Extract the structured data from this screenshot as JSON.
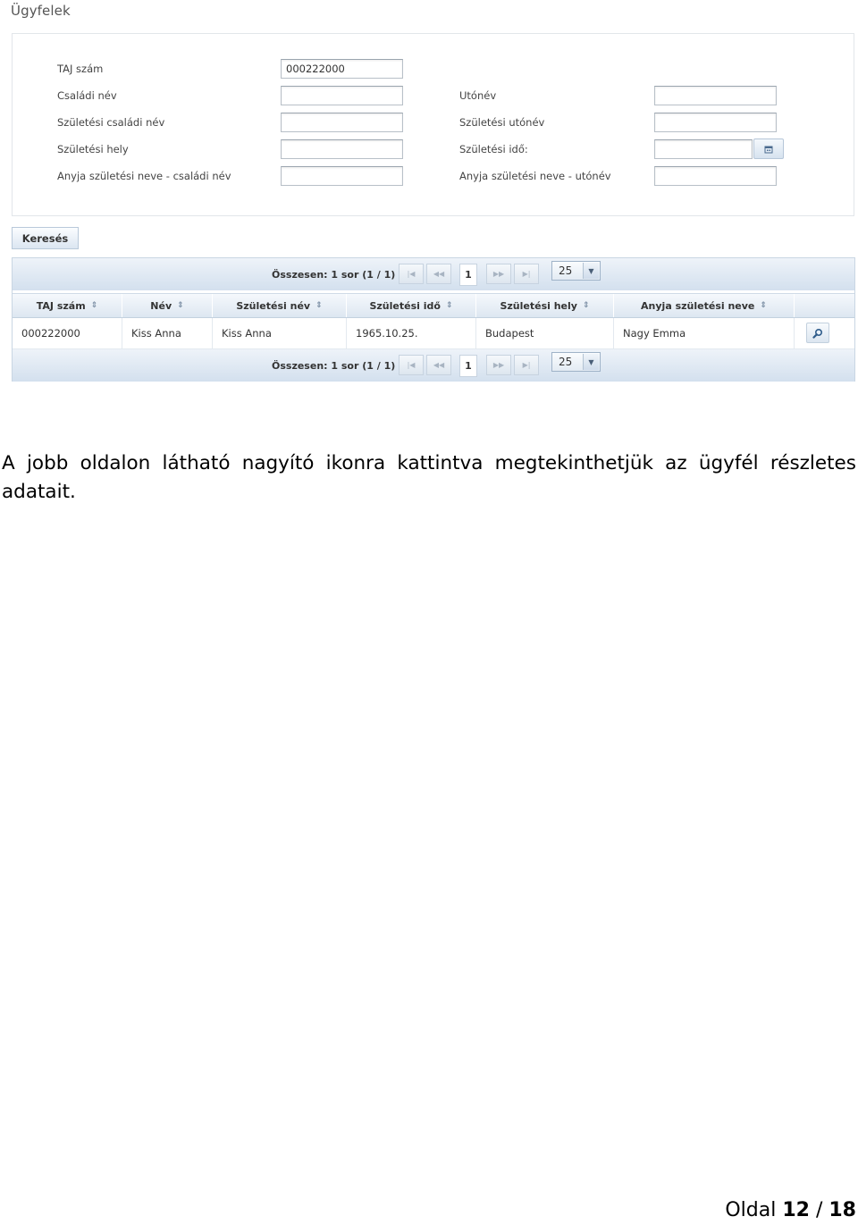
{
  "page": {
    "title": "Ügyfelek"
  },
  "search_form": {
    "fields": [
      {
        "label": "TAJ szám",
        "value": "000222000"
      },
      {
        "label": "Családi név",
        "value": ""
      },
      {
        "label": "Utónév",
        "value": ""
      },
      {
        "label": "Születési családi név",
        "value": ""
      },
      {
        "label": "Születési utónév",
        "value": ""
      },
      {
        "label": "Születési hely",
        "value": ""
      },
      {
        "label": "Születési idő:",
        "value": ""
      },
      {
        "label": "Anyja születési neve - családi név",
        "value": ""
      },
      {
        "label": "Anyja születési neve - utónév",
        "value": ""
      }
    ],
    "search_button": "Keresés"
  },
  "grid": {
    "pager": {
      "summary": "Összesen: 1 sor (1 / 1)",
      "current_page": "1",
      "page_size": "25",
      "first": "|◀",
      "prev": "◀◀",
      "next": "▶▶",
      "last": "▶|"
    },
    "columns": [
      {
        "label": "TAJ szám"
      },
      {
        "label": "Név"
      },
      {
        "label": "Születési név"
      },
      {
        "label": "Születési idő"
      },
      {
        "label": "Születési hely"
      },
      {
        "label": "Anyja születési neve"
      }
    ],
    "rows": [
      [
        "000222000",
        "Kiss Anna",
        "Kiss Anna",
        "1965.10.25.",
        "Budapest",
        "Nagy Emma"
      ]
    ],
    "sort_glyph": "⇕"
  },
  "document": {
    "paragraph": "A jobb oldalon látható nagyító ikonra kattintva megtekinthetjük az ügyfél részletes adatait.",
    "footer_prefix": "Oldal",
    "page_number": "12",
    "separator": "/",
    "total_pages": "18"
  },
  "icons": {
    "calendar": "calendar-icon",
    "magnifier": "magnifier-icon",
    "dropdown": "chevron-down-icon",
    "sort": "sort-icon"
  },
  "colors": {
    "header_gradient_top": "#f5f8fc",
    "header_gradient_bottom": "#dde7f1",
    "pager_gradient_top": "#eef3f9",
    "pager_gradient_bottom": "#d3e0ee",
    "border": "#c9d6e3"
  }
}
